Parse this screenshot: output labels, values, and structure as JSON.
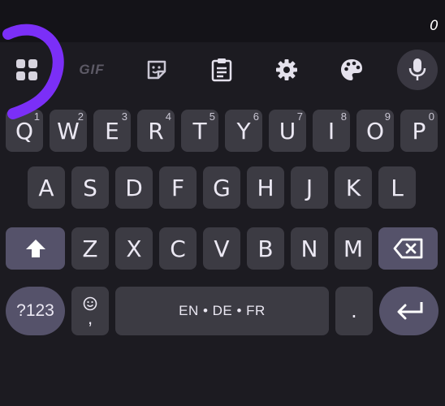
{
  "status": {
    "counter": "0"
  },
  "toolbar": {
    "items": [
      {
        "icon": "apps-grid-icon"
      },
      {
        "icon": "gif-icon",
        "label": "GIF"
      },
      {
        "icon": "sticker-icon"
      },
      {
        "icon": "clipboard-icon"
      },
      {
        "icon": "gear-icon"
      },
      {
        "icon": "palette-icon"
      },
      {
        "icon": "mic-icon"
      }
    ]
  },
  "keyboard": {
    "row1": [
      {
        "label": "Q",
        "hint": "1"
      },
      {
        "label": "W",
        "hint": "2"
      },
      {
        "label": "E",
        "hint": "3"
      },
      {
        "label": "R",
        "hint": "4"
      },
      {
        "label": "T",
        "hint": "5"
      },
      {
        "label": "Y",
        "hint": "6"
      },
      {
        "label": "U",
        "hint": "7"
      },
      {
        "label": "I",
        "hint": "8"
      },
      {
        "label": "O",
        "hint": "9"
      },
      {
        "label": "P",
        "hint": "0"
      }
    ],
    "row2": [
      "A",
      "S",
      "D",
      "F",
      "G",
      "H",
      "J",
      "K",
      "L"
    ],
    "row3": [
      "Z",
      "X",
      "C",
      "V",
      "B",
      "N",
      "M"
    ],
    "symbols_label": "?123",
    "emoji_comma": ",",
    "space_label": "EN • DE • FR",
    "period_label": ".",
    "colors": {
      "key": "#3c3b43",
      "func_key": "#55526a",
      "background": "#1c1b21",
      "annotation": "#7b2ff7"
    }
  }
}
